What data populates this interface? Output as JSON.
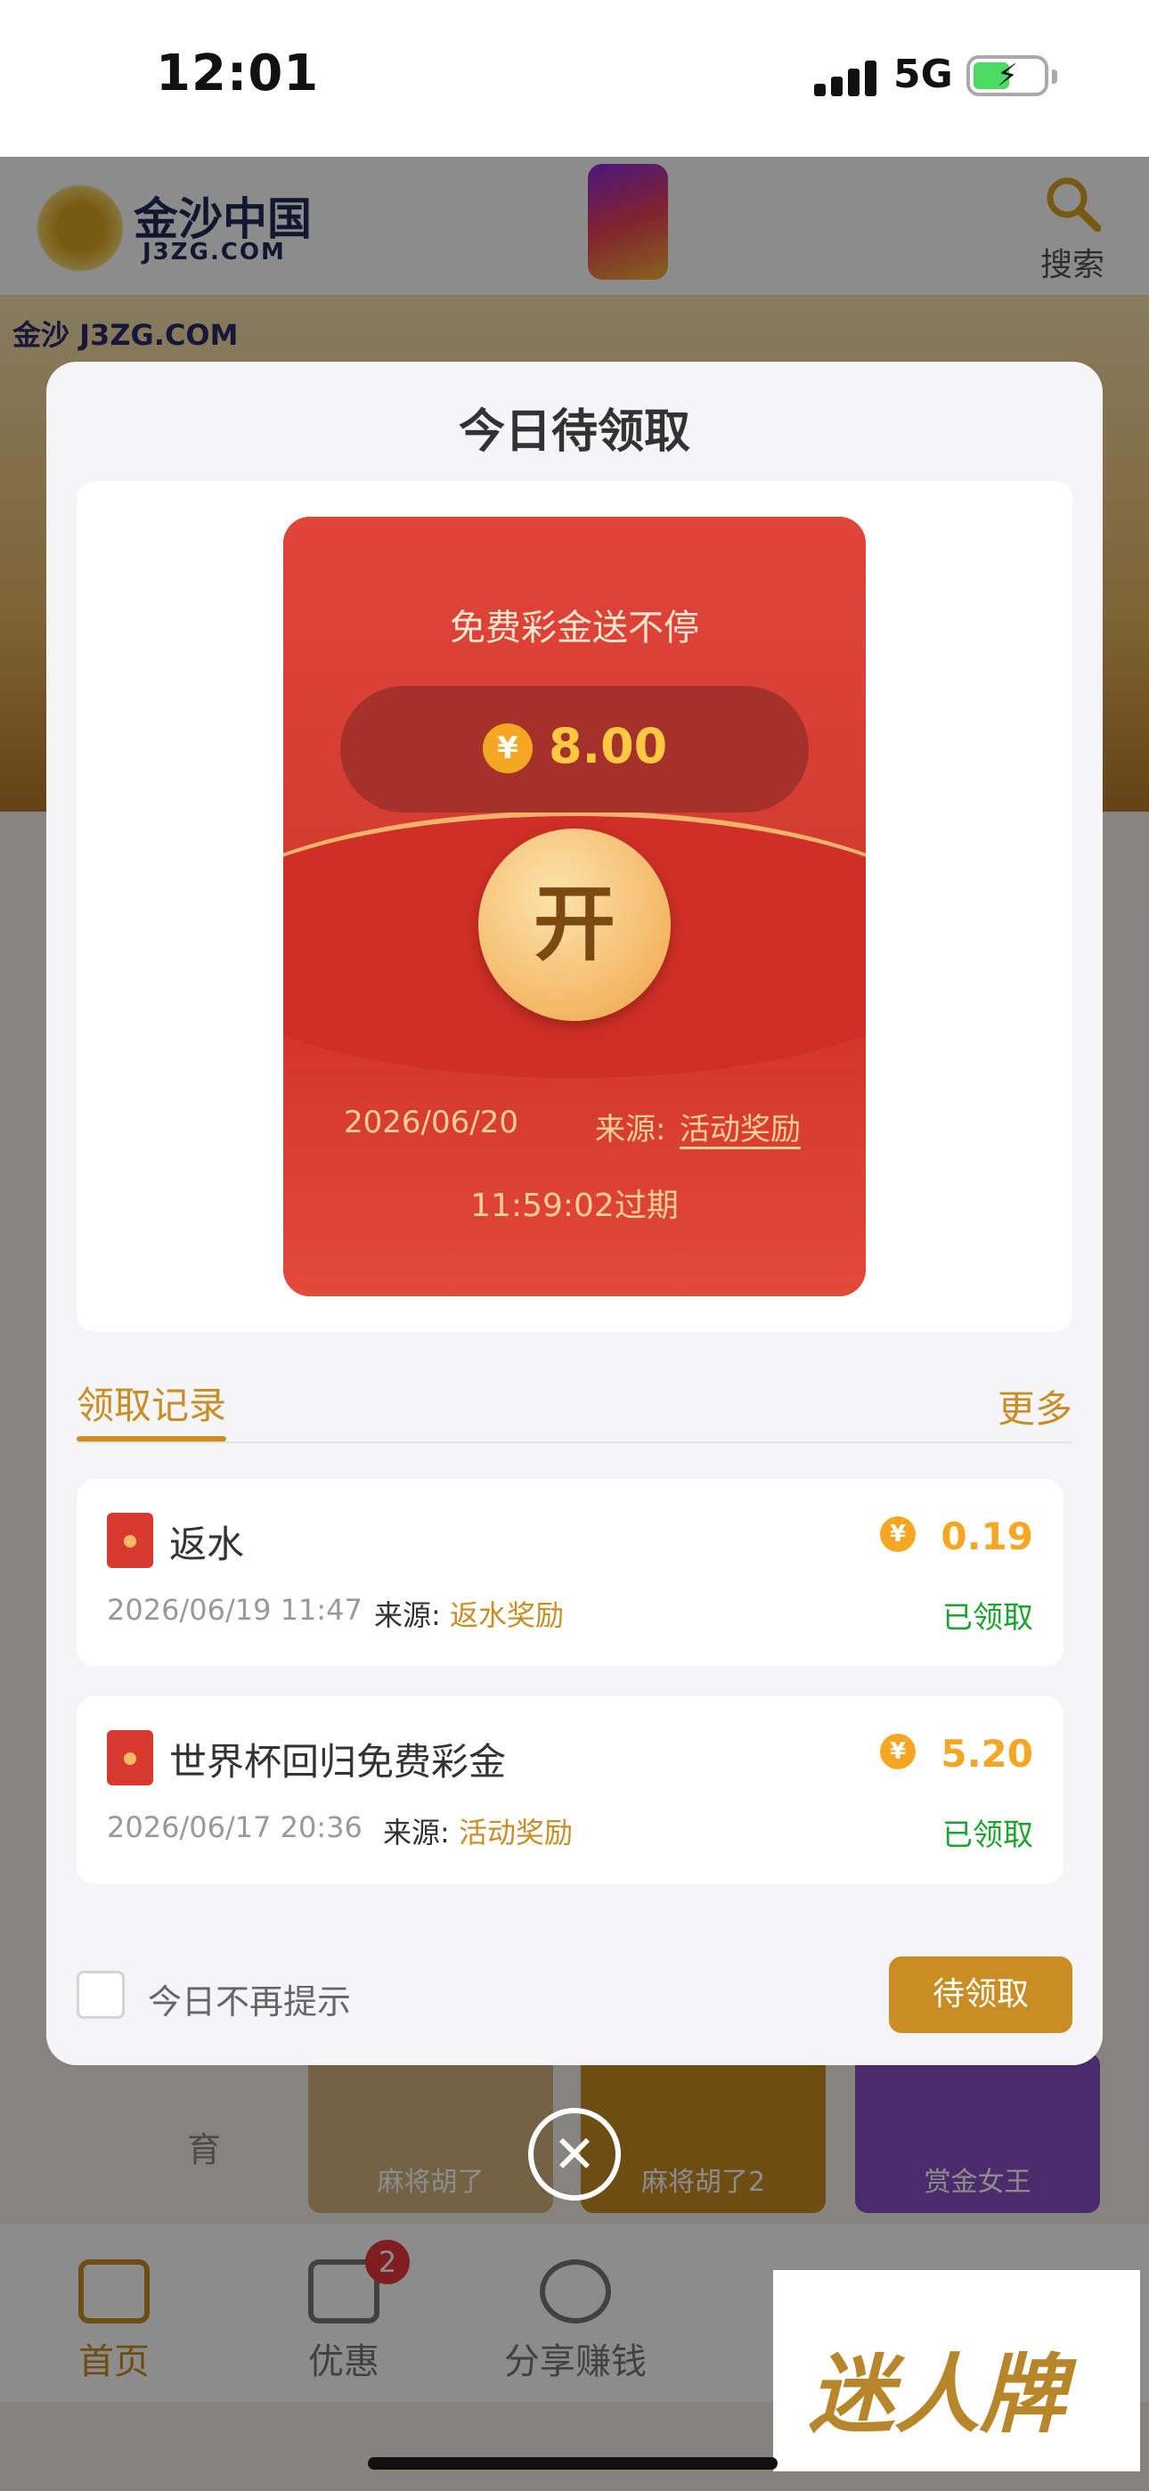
{
  "status_bar": {
    "time": "12:01",
    "network": "5G",
    "battery_color": "#4cd964"
  },
  "background_app": {
    "logo_text": "金沙中国",
    "logo_sub": "J3ZG.COM",
    "search_label": "搜索",
    "banner_text": "金沙 J3ZG.COM",
    "game_tiles": [
      {
        "label": "麻将胡了"
      },
      {
        "label": "麻将胡了2"
      },
      {
        "label": "赏金女王"
      }
    ],
    "promo_label": "育",
    "bottom_nav": [
      {
        "label": "首页"
      },
      {
        "label": "优惠",
        "badge": "2"
      },
      {
        "label": "分享赚钱"
      }
    ]
  },
  "modal": {
    "title": "今日待领取",
    "envelope": {
      "slogan": "免费彩金送不停",
      "currency_symbol": "¥",
      "amount": "8.00",
      "open_label": "开",
      "date": "2026/06/20",
      "source_label": "来源:",
      "source": "活动奖励",
      "expire": "11:59:02过期"
    },
    "tabs": {
      "active": "领取记录",
      "more": "更多"
    },
    "records": [
      {
        "title": "返水",
        "amount": "0.19",
        "date": "2026/06/19 11:47",
        "source_label": "来源:",
        "source": "返水奖励",
        "status": "已领取"
      },
      {
        "title": "世界杯回归免费彩金",
        "amount": "5.20",
        "date": "2026/06/17 20:36",
        "source_label": "来源:",
        "source": "活动奖励",
        "status": "已领取"
      }
    ],
    "footer": {
      "checkbox_label": "今日不再提示",
      "button_label": "待领取"
    }
  },
  "watermark": "迷人牌",
  "colors": {
    "accent": "#c98d24",
    "envelope_red": "#d83a30",
    "claimed_green": "#1aa52f",
    "coin": "#f5a623"
  }
}
